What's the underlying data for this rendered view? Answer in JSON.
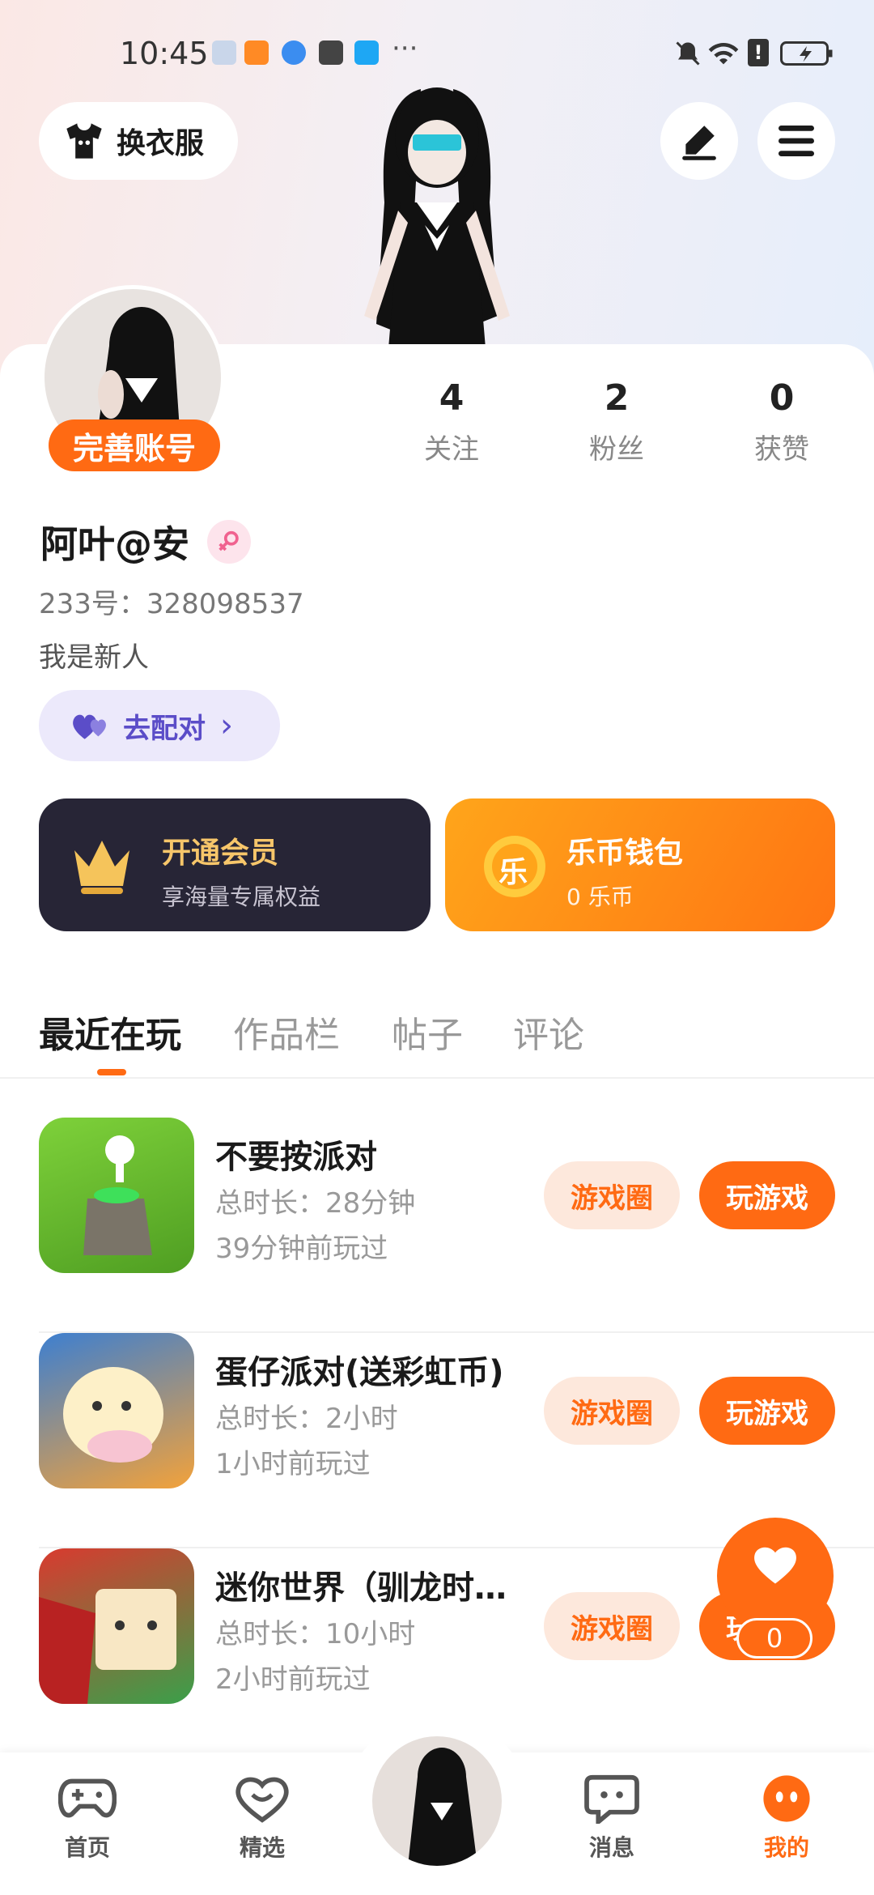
{
  "status": {
    "time": "10:45",
    "more": "···"
  },
  "header": {
    "outfit_label": "换衣服"
  },
  "profile": {
    "complete_label": "完善账号",
    "stats": [
      {
        "value": "4",
        "label": "关注"
      },
      {
        "value": "2",
        "label": "粉丝"
      },
      {
        "value": "0",
        "label": "获赞"
      }
    ],
    "name": "阿叶@安",
    "id_text": "233号：328098537",
    "bio": "我是新人",
    "match_label": "去配对",
    "match_arrow": "›"
  },
  "cards": {
    "vip": {
      "title": "开通会员",
      "subtitle": "享海量专属权益"
    },
    "wallet": {
      "title": "乐币钱包",
      "subtitle": "0 乐币",
      "coin_char": "乐"
    }
  },
  "tabs": [
    "最近在玩",
    "作品栏",
    "帖子",
    "评论"
  ],
  "games": [
    {
      "name": "不要按派对",
      "duration": "总时长：28分钟",
      "last_played": "39分钟前玩过",
      "circle": "游戏圈",
      "play": "玩游戏"
    },
    {
      "name": "蛋仔派对(送彩虹币)",
      "duration": "总时长：2小时",
      "last_played": "1小时前玩过",
      "circle": "游戏圈",
      "play": "玩游戏"
    },
    {
      "name": "迷你世界（驯龙时…",
      "duration": "总时长：10小时",
      "last_played": "2小时前玩过",
      "circle": "游戏圈",
      "play": "玩游戏"
    }
  ],
  "fab": {
    "count": "0"
  },
  "nav": [
    {
      "label": "首页"
    },
    {
      "label": "精选"
    },
    {
      "label": "消息"
    },
    {
      "label": "我的"
    }
  ],
  "colors": {
    "accent": "#ff6a13",
    "vip_bg": "#272536",
    "match_bg": "#ece9fb"
  }
}
